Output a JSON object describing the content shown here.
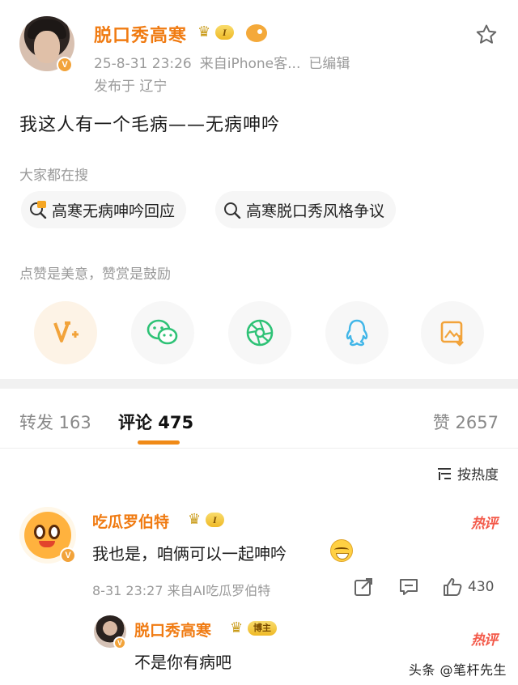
{
  "post": {
    "author": "脱口秀高寒",
    "level": "I",
    "time": "25-8-31 23:26",
    "source": "来自iPhone客...",
    "edited": "已编辑",
    "location": "发布于 辽宁",
    "text": "我这人有一个毛病——无病呻吟"
  },
  "search": {
    "title": "大家都在搜",
    "chips": [
      "高寒无病呻吟回应",
      "高寒脱口秀风格争议"
    ]
  },
  "reward": {
    "title": "点赞是美意，赞赏是鼓励"
  },
  "tabs": {
    "repost": "转发 163",
    "comment": "评论 475",
    "like": "赞 2657"
  },
  "sort": {
    "label": "按热度"
  },
  "comment": {
    "author": "吃瓜罗伯特",
    "level": "I",
    "tag": "热评",
    "text": "我也是，咱俩可以一起呻吟",
    "meta": "8-31 23:27 来自AI吃瓜罗伯特",
    "likes": "430"
  },
  "reply": {
    "author": "脱口秀高寒",
    "badge": "博主",
    "tag": "热评",
    "text": "不是你有病吧"
  },
  "watermark": "头条 @笔杆先生",
  "colors": {
    "accent": "#f07b12",
    "hot": "#f35a4a",
    "wechat": "#2ec276",
    "qq": "#41b6e8"
  }
}
